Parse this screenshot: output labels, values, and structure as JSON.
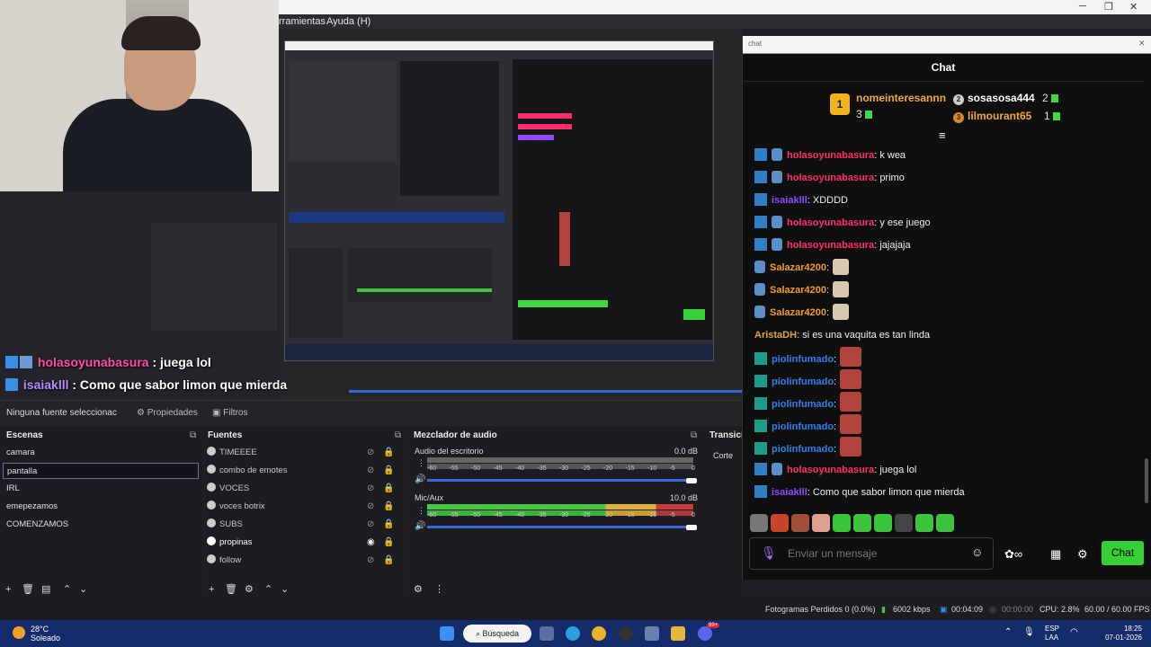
{
  "window": {
    "menu_tools": "rramientas",
    "menu_help": "Ayuda (H)",
    "min": "─",
    "max": "❐",
    "close": "✕"
  },
  "overlay": {
    "line1_user": "holasoyunabasura",
    "line1_text": " : juega lol",
    "line2_user": "isaiaklll",
    "line2_text": " : Como que sabor limon que mierda"
  },
  "toolbar": {
    "no_source": "Ninguna fuente seleccionac",
    "properties": "Propiedades",
    "filters": "Filtros"
  },
  "scenes": {
    "title": "Escenas",
    "items": [
      "camara",
      "pantalla",
      "IRL",
      "emepezamos",
      "COMENZAMOS"
    ],
    "selected_index": 1
  },
  "sources": {
    "title": "Fuentes",
    "items": [
      "TIMEEEE",
      "combo de emotes",
      "VOCES",
      "voces botrix",
      "SUBS",
      "propinas",
      "follow"
    ]
  },
  "mixer": {
    "title": "Mezclador de audio",
    "channels": [
      {
        "name": "Audio del escritorio",
        "db": "0.0 dB",
        "level": 0.0
      },
      {
        "name": "Mic/Aux",
        "db": "10.0 dB",
        "level": 0.98
      }
    ],
    "scale": [
      "-60",
      "-55",
      "-50",
      "-45",
      "-40",
      "-35",
      "-30",
      "-25",
      "-20",
      "-15",
      "-10",
      "-5",
      "0"
    ]
  },
  "transitions": {
    "title": "Transici",
    "cut": "Corte"
  },
  "status": {
    "dropped": "Fotogramas Perdidos 0 (0.0%)",
    "kbps": "6002 kbps",
    "live_time": "00:04:09",
    "rec_time": "00:00:00",
    "cpu": "CPU: 2.8%",
    "fps": "60.00 / 60.00 FPS"
  },
  "taskbar": {
    "weather_temp": "28°C",
    "weather_desc": "Soleado",
    "search": "Búsqueda",
    "lang": "ESP",
    "region": "LAA",
    "time": "18:25",
    "date": "07-01-2026",
    "badge": "99+"
  },
  "chat": {
    "window_title": "chat",
    "header": "Chat",
    "leaderboard": [
      {
        "rank": "1",
        "name": "nomeinteresannn",
        "count": "3"
      },
      {
        "rank": "2",
        "name": "sosasosa444",
        "count": "2"
      },
      {
        "rank": "3",
        "name": "lilmourant65",
        "count": "1"
      }
    ],
    "messages": [
      {
        "user": "holasoyunabasura",
        "text": ": k wea",
        "color": "pink",
        "badges": 2
      },
      {
        "user": "holasoyunabasura",
        "text": ": primo",
        "color": "pink",
        "badges": 2
      },
      {
        "user": "isaiaklll",
        "text": ": XDDDD",
        "color": "purp",
        "badges": 1
      },
      {
        "user": "holasoyunabasura",
        "text": ": y ese juego",
        "color": "pink",
        "badges": 2
      },
      {
        "user": "holasoyunabasura",
        "text": ": jajajaja",
        "color": "pink",
        "badges": 2
      },
      {
        "user": "Salazar4200",
        "text": ":",
        "color": "orange",
        "badges": 3,
        "emote": "cat"
      },
      {
        "user": "Salazar4200",
        "text": ":",
        "color": "orange",
        "badges": 3,
        "emote": "cat"
      },
      {
        "user": "Salazar4200",
        "text": ":",
        "color": "orange",
        "badges": 3,
        "emote": "cat"
      },
      {
        "user": "AristaDH",
        "text": ": si es una vaquita es tan linda",
        "color": "yellow",
        "badges": 0
      },
      {
        "user": "piolinfumado",
        "text": ":",
        "color": "blue",
        "badges": 4,
        "emote": "face"
      },
      {
        "user": "piolinfumado",
        "text": ":",
        "color": "blue",
        "badges": 4,
        "emote": "face"
      },
      {
        "user": "piolinfumado",
        "text": ":",
        "color": "blue",
        "badges": 4,
        "emote": "face"
      },
      {
        "user": "piolinfumado",
        "text": ":",
        "color": "blue",
        "badges": 4,
        "emote": "face"
      },
      {
        "user": "piolinfumado",
        "text": ":",
        "color": "blue",
        "badges": 4,
        "emote": "face"
      },
      {
        "user": "holasoyunabasura",
        "text": ": juega lol",
        "color": "pink",
        "badges": 2
      },
      {
        "user": "isaiaklll",
        "text": ": Como que sabor limon que mierda",
        "color": "purp",
        "badges": 1
      }
    ],
    "input_placeholder": "Enviar un mensaje",
    "send_label": "Chat",
    "accent": "#35d035"
  }
}
